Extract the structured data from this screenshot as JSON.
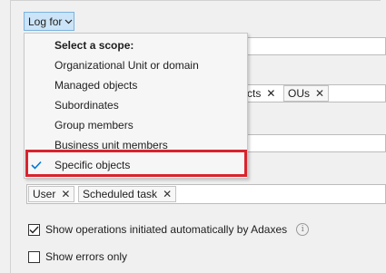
{
  "log_for": {
    "label": "Log for"
  },
  "menu": {
    "header": "Select a scope:",
    "items": [
      {
        "label": "Organizational Unit or domain",
        "checked": false
      },
      {
        "label": "Managed objects",
        "checked": false
      },
      {
        "label": "Subordinates",
        "checked": false
      },
      {
        "label": "Group members",
        "checked": false
      },
      {
        "label": "Business unit members",
        "checked": false
      },
      {
        "label": "Specific objects",
        "checked": true
      }
    ]
  },
  "scope_field": {
    "partial_chip": "cts",
    "chips": [
      {
        "label": "OUs"
      }
    ]
  },
  "operations_field": {
    "chips": [
      {
        "label": "User"
      },
      {
        "label": "Scheduled task"
      }
    ]
  },
  "options": {
    "show_automatic": {
      "label": "Show operations initiated automatically by Adaxes",
      "checked": true
    },
    "show_errors": {
      "label": "Show errors only",
      "checked": false
    }
  },
  "colors": {
    "accent": "#0078d7",
    "highlight": "#d9232d",
    "button_bg": "#cce4f7"
  }
}
